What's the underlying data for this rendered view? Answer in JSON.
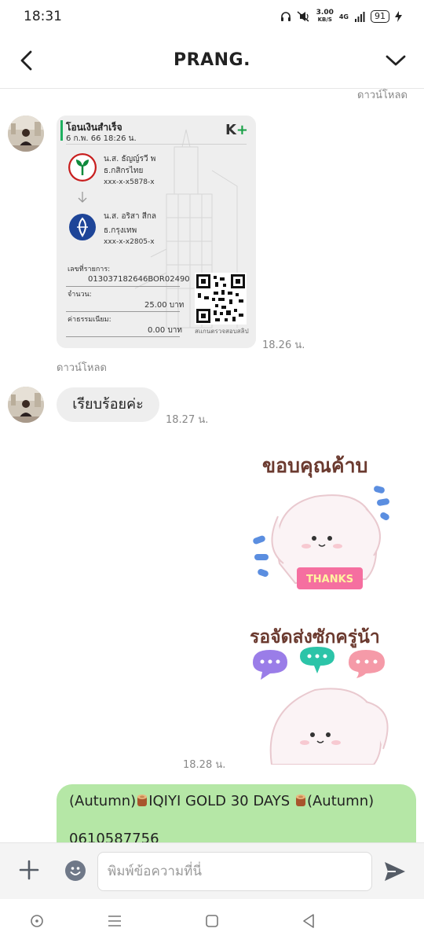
{
  "status_bar": {
    "time": "18:31",
    "net_speed_value": "3.00",
    "net_speed_unit": "KB/S",
    "signal_label": "4G",
    "battery": "91"
  },
  "header": {
    "title": "PRANG."
  },
  "chat": {
    "download_label_top": "ดาวน์โหลด",
    "slip": {
      "title": "โอนเงินสำเร็จ",
      "date": "6 ก.พ. 66  18:26 น.",
      "logo": "K+",
      "sender_name": "น.ส. ธัญญ์รวี พ",
      "sender_bank": "ธ.กสิกรไทย",
      "sender_account": "xxx-x-x5878-x",
      "receiver_name": "น.ส. อริสา สีกล",
      "receiver_bank": "ธ.กรุงเทพ",
      "receiver_account": "xxx-x-x2805-x",
      "ref_label": "เลขที่รายการ:",
      "ref_value": "013037182646BOR02490",
      "amount_label": "จำนวน:",
      "amount_value": "25.00 บาท",
      "fee_label": "ค่าธรรมเนียม:",
      "fee_value": "0.00 บาท",
      "qr_caption": "สแกนตรวจสอบสลิป"
    },
    "slip_time": "18.26 น.",
    "download_label": "ดาวน์โหลด",
    "reply_text": "เรียบร้อยค่ะ",
    "reply_time": "18.27 น.",
    "sticker1_text": "ขอบคุณค้าบ",
    "sticker1_banner": "THANKS",
    "sticker2_text": "รอจัดส่งซักครู่น้า",
    "sticker_time": "18.28 น.",
    "outgoing_line1_a": "(Autumn)",
    "outgoing_line1_b": "IQIYI GOLD 30 DAYS ",
    "outgoing_line1_c": "(Autumn)",
    "outgoing_line2": "0610587756"
  },
  "input_bar": {
    "placeholder": "พิมพ์ข้อความที่นี่"
  },
  "colors": {
    "outgoing_bubble": "#b5e7a6",
    "incoming_bubble": "#eeeeee",
    "kplus_green": "#18a046"
  }
}
